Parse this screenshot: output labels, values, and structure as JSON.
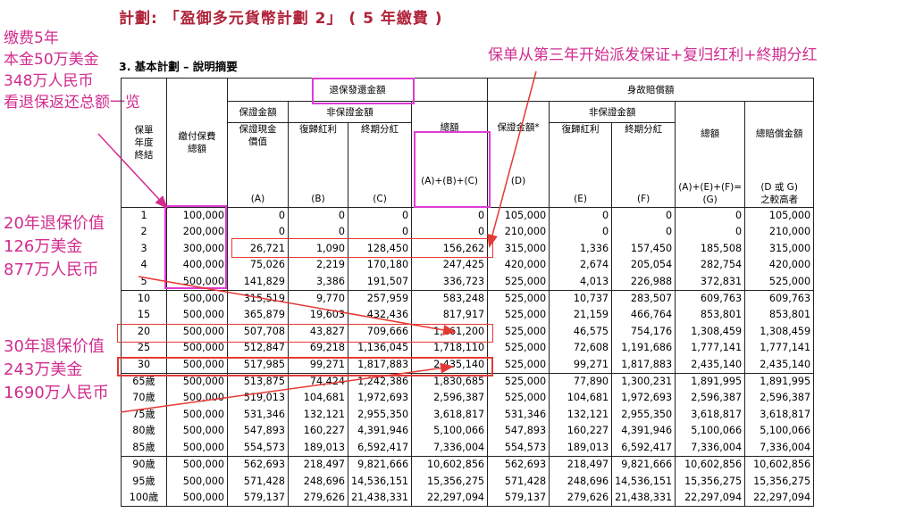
{
  "page_title": "計劃: 「盈御多元貨幣計劃 2」 ( 5 年繳費 )",
  "section_title": "3.  基本計劃 – 說明摘要",
  "annotations": {
    "left_top": [
      "缴费5年",
      "本金50万美金",
      "348万人民币",
      "看退保返还总额一览"
    ],
    "left_mid": [
      "20年退保价值",
      "126万美金",
      "877万人民币"
    ],
    "left_bottom": [
      "30年退保价值",
      "243万美金",
      "1690万人民币"
    ],
    "top_right": "保单从第三年开始派发保证+复归红利+終期分红"
  },
  "headers": {
    "policy_year": "保單\n年度\n終結",
    "premium": "繳付保費\n總額",
    "surrender_group": "退保發還金額",
    "guaranteed_amount": "保證金額",
    "non_guaranteed": "非保證金額",
    "guaranteed_cash_value": "保證現金\n價值",
    "reversionary_bonus": "復歸紅利",
    "terminal_bonus": "終期分紅",
    "total": "總額",
    "col_a": "(A)",
    "col_b": "(B)",
    "col_c": "(C)",
    "col_abc": "(A)+(B)+(C)",
    "death_group": "身故賠償額",
    "death_guaranteed": "保證金額*",
    "death_non_guaranteed": "非保證金額",
    "death_rev_bonus": "復歸紅利",
    "death_terminal_bonus": "終期分紅",
    "death_total": "總額",
    "total_death_benefit": "總賠償金額",
    "col_d": "(D)",
    "col_e": "(E)",
    "col_f": "(F)",
    "col_g": "(A)+(E)+(F)=\n(G)",
    "col_dg": "(D 或 G)\n之較高者"
  },
  "rows": [
    [
      "1",
      "100,000",
      "0",
      "0",
      "0",
      "0",
      "105,000",
      "0",
      "0",
      "0",
      "105,000"
    ],
    [
      "2",
      "200,000",
      "0",
      "0",
      "0",
      "0",
      "210,000",
      "0",
      "0",
      "0",
      "210,000"
    ],
    [
      "3",
      "300,000",
      "26,721",
      "1,090",
      "128,450",
      "156,262",
      "315,000",
      "1,336",
      "157,450",
      "185,508",
      "315,000"
    ],
    [
      "4",
      "400,000",
      "75,026",
      "2,219",
      "170,180",
      "247,425",
      "420,000",
      "2,674",
      "205,054",
      "282,754",
      "420,000"
    ],
    [
      "5",
      "500,000",
      "141,829",
      "3,386",
      "191,507",
      "336,723",
      "525,000",
      "4,013",
      "226,988",
      "372,831",
      "525,000"
    ],
    [
      "10",
      "500,000",
      "315,519",
      "9,770",
      "257,959",
      "583,248",
      "525,000",
      "10,737",
      "283,507",
      "609,763",
      "609,763"
    ],
    [
      "15",
      "500,000",
      "365,879",
      "19,603",
      "432,436",
      "817,917",
      "525,000",
      "21,159",
      "466,764",
      "853,801",
      "853,801"
    ],
    [
      "20",
      "500,000",
      "507,708",
      "43,827",
      "709,666",
      "1,261,200",
      "525,000",
      "46,575",
      "754,176",
      "1,308,459",
      "1,308,459"
    ],
    [
      "25",
      "500,000",
      "512,847",
      "69,218",
      "1,136,045",
      "1,718,110",
      "525,000",
      "72,608",
      "1,191,686",
      "1,777,141",
      "1,777,141"
    ],
    [
      "30",
      "500,000",
      "517,985",
      "99,271",
      "1,817,883",
      "2,435,140",
      "525,000",
      "99,271",
      "1,817,883",
      "2,435,140",
      "2,435,140"
    ],
    [
      "65歲",
      "500,000",
      "513,875",
      "74,424",
      "1,242,386",
      "1,830,685",
      "525,000",
      "77,890",
      "1,300,231",
      "1,891,995",
      "1,891,995"
    ],
    [
      "70歲",
      "500,000",
      "519,013",
      "104,681",
      "1,972,693",
      "2,596,387",
      "525,000",
      "104,681",
      "1,972,693",
      "2,596,387",
      "2,596,387"
    ],
    [
      "75歲",
      "500,000",
      "531,346",
      "132,121",
      "2,955,350",
      "3,618,817",
      "531,346",
      "132,121",
      "2,955,350",
      "3,618,817",
      "3,618,817"
    ],
    [
      "80歲",
      "500,000",
      "547,893",
      "160,227",
      "4,391,946",
      "5,100,066",
      "547,893",
      "160,227",
      "4,391,946",
      "5,100,066",
      "5,100,066"
    ],
    [
      "85歲",
      "500,000",
      "554,573",
      "189,013",
      "6,592,417",
      "7,336,004",
      "554,573",
      "189,013",
      "6,592,417",
      "7,336,004",
      "7,336,004"
    ],
    [
      "90歲",
      "500,000",
      "562,693",
      "218,497",
      "9,821,666",
      "10,602,856",
      "562,693",
      "218,497",
      "9,821,666",
      "10,602,856",
      "10,602,856"
    ],
    [
      "95歲",
      "500,000",
      "571,428",
      "248,696",
      "14,536,151",
      "15,356,275",
      "571,428",
      "248,696",
      "14,536,151",
      "15,356,275",
      "15,356,275"
    ],
    [
      "100歲",
      "500,000",
      "579,137",
      "279,626",
      "21,438,331",
      "22,297,094",
      "579,137",
      "279,626",
      "21,438,331",
      "22,297,094",
      "22,297,094"
    ]
  ],
  "colors": {
    "title": "#b0243a",
    "annotation": "#d12c8f",
    "highlight_box": "#e03bd6",
    "arrow": "#e53935"
  }
}
